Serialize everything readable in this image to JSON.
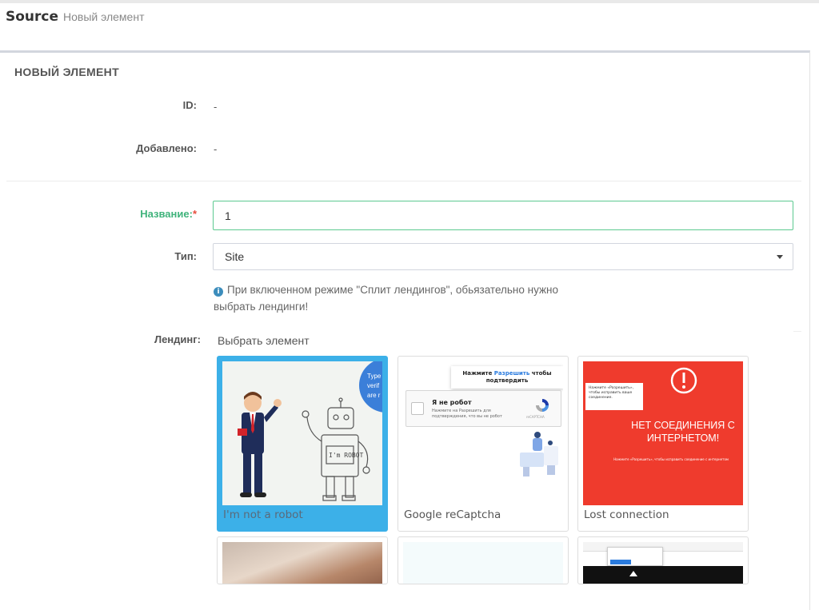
{
  "header": {
    "title": "Source",
    "subtitle": "Новый элемент"
  },
  "form": {
    "section_title": "НОВЫЙ ЭЛЕМЕНТ",
    "id": {
      "label": "ID:",
      "value": "-"
    },
    "added": {
      "label": "Добавлено:",
      "value": "-"
    },
    "name": {
      "label": "Название:",
      "required_mark": "*",
      "value": "1"
    },
    "type": {
      "label": "Тип:",
      "value": "Site"
    },
    "hint": "При включенном режиме \"Сплит лендингов\", обьязательно нужно выбрать лендинги!",
    "landing": {
      "label": "Лендинг:",
      "picker_title": "Выбрать элемент"
    }
  },
  "cards": [
    {
      "caption": "I'm not a robot",
      "selected": true,
      "thumb_text": [
        "Type",
        "verif",
        "are r"
      ],
      "sign": "I'm ROBOT"
    },
    {
      "caption": "Google reCaptcha",
      "selected": false,
      "dialog_title": "Нажмите",
      "dialog_link": "Разрешить",
      "dialog_tail": "чтобы подтвердить",
      "checkbox_label": "Я не робот",
      "checkbox_sub": "Нажмите на Разрешить для подтверждения, что вы не робот",
      "recaptcha_mini": "reCAPTCHA"
    },
    {
      "caption": "Lost connection",
      "selected": false,
      "popup_text": "Нажмите «Разрешить», чтобы исправить ваше соединение.",
      "headline": "НЕТ СОЕДИНЕНИЯ С ИНТЕРНЕТОМ!",
      "footer_text": "Нажмите «Разрешить», чтобы исправить соединение с интернетом"
    }
  ],
  "colors": {
    "accent_green": "#5cc990",
    "selected_card": "#3cb0e8",
    "red_bg": "#ef3b2d",
    "info": "#3c8dbc"
  }
}
